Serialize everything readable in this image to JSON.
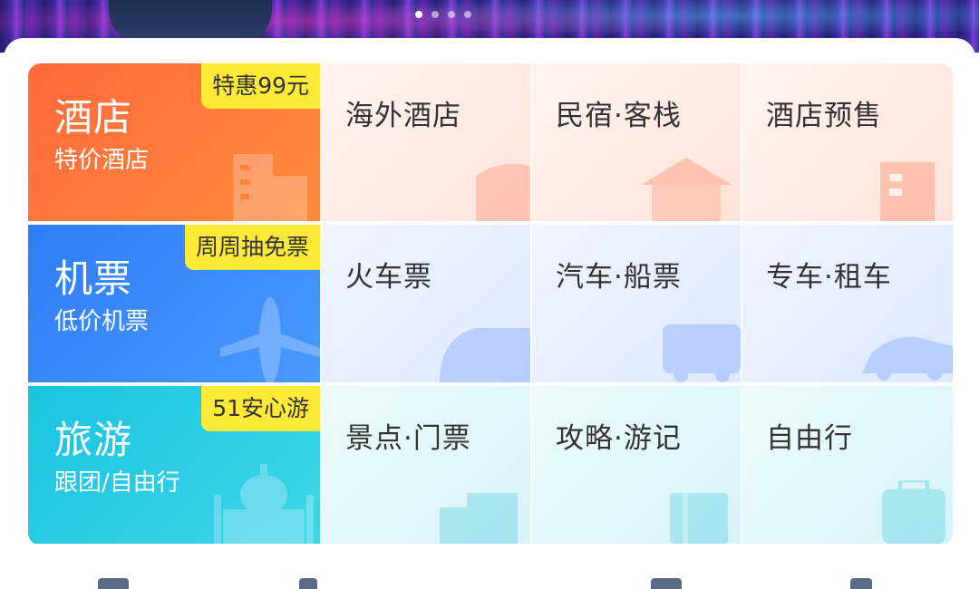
{
  "banner": {
    "page_count": 4,
    "active_index": 0
  },
  "rows": [
    {
      "title": "酒店",
      "subtitle": "特价酒店",
      "badge": "特惠99元",
      "color": "#ff6a3c",
      "icon": "building-icon",
      "items": [
        {
          "label": "海外酒店",
          "icon": "overseas-hotel-icon"
        },
        {
          "label": "民宿·客栈",
          "icon": "house-icon"
        },
        {
          "label": "酒店预售",
          "icon": "hotel-presale-icon"
        }
      ]
    },
    {
      "title": "机票",
      "subtitle": "低价机票",
      "badge": "周周抽免票",
      "color": "#2f7df6",
      "icon": "airplane-icon",
      "items": [
        {
          "label": "火车票",
          "icon": "train-icon"
        },
        {
          "label": "汽车·船票",
          "icon": "bus-icon"
        },
        {
          "label": "专车·租车",
          "icon": "car-icon"
        }
      ]
    },
    {
      "title": "旅游",
      "subtitle": "跟团/自由行",
      "badge": "51安心游",
      "color": "#19c3e0",
      "icon": "landmark-icon",
      "items": [
        {
          "label": "景点·门票",
          "icon": "ticket-icon"
        },
        {
          "label": "攻略·游记",
          "icon": "book-icon"
        },
        {
          "label": "自由行",
          "icon": "luggage-icon"
        }
      ]
    }
  ]
}
